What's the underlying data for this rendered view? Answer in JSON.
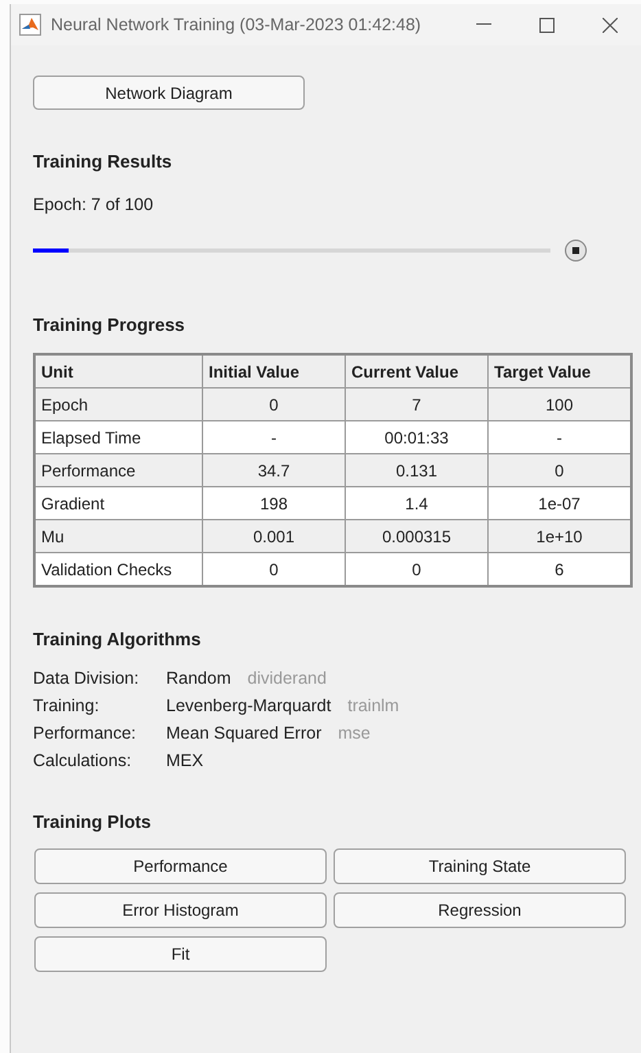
{
  "window": {
    "title": "Neural Network Training (03-Mar-2023 01:42:48)"
  },
  "network_button": "Network Diagram",
  "training_results": {
    "heading": "Training Results",
    "epoch_text": "Epoch: 7 of 100",
    "progress": {
      "level": 0.07
    }
  },
  "training_progress": {
    "heading": "Training Progress",
    "columns": [
      "Unit",
      "Initial Value",
      "Current Value",
      "Target Value"
    ],
    "rows": [
      [
        "Epoch",
        "0",
        "7",
        "100"
      ],
      [
        "Elapsed Time",
        "-",
        "00:01:33",
        "-"
      ],
      [
        "Performance",
        "34.7",
        "0.131",
        "0"
      ],
      [
        "Gradient",
        "198",
        "1.4",
        "1e-07"
      ],
      [
        "Mu",
        "0.001",
        "0.000315",
        "1e+10"
      ],
      [
        "Validation Checks",
        "0",
        "0",
        "6"
      ]
    ]
  },
  "training_algorithms": {
    "heading": "Training Algorithms",
    "rows": [
      {
        "label": "Data Division:",
        "value": "Random",
        "function": "dividerand"
      },
      {
        "label": "Training:",
        "value": "Levenberg-Marquardt",
        "function": "trainlm"
      },
      {
        "label": "Performance:",
        "value": "Mean Squared Error",
        "function": "mse"
      },
      {
        "label": "Calculations:",
        "value": "MEX"
      }
    ]
  },
  "training_plots": {
    "heading": "Training Plots",
    "buttons": [
      "Performance",
      "Training State",
      "Error Histogram",
      "Regression",
      "Fit"
    ]
  }
}
